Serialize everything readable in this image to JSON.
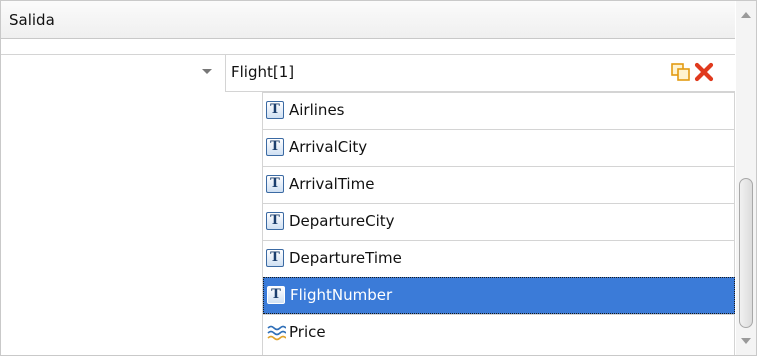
{
  "panel": {
    "title": "Salida"
  },
  "node": {
    "label": "Flight[1]",
    "expander_icon": "chevron-down-icon",
    "actions": [
      {
        "name": "copy-icon",
        "color": "#f5a623"
      },
      {
        "name": "close-icon",
        "color": "#e03a1e"
      }
    ]
  },
  "fields": [
    {
      "label": "Airlines",
      "icon": "text-field-icon",
      "icon_glyph": "T",
      "selected": false
    },
    {
      "label": "ArrivalCity",
      "icon": "text-field-icon",
      "icon_glyph": "T",
      "selected": false
    },
    {
      "label": "ArrivalTime",
      "icon": "text-field-icon",
      "icon_glyph": "T",
      "selected": false
    },
    {
      "label": "DepartureCity",
      "icon": "text-field-icon",
      "icon_glyph": "T",
      "selected": false
    },
    {
      "label": "DepartureTime",
      "icon": "text-field-icon",
      "icon_glyph": "T",
      "selected": false
    },
    {
      "label": "FlightNumber",
      "icon": "text-field-icon",
      "icon_glyph": "T",
      "selected": true
    },
    {
      "label": "Price",
      "icon": "number-field-icon",
      "selected": false
    }
  ],
  "colors": {
    "selection": "#3b7bd8",
    "grid_line": "#d4d4d4"
  }
}
